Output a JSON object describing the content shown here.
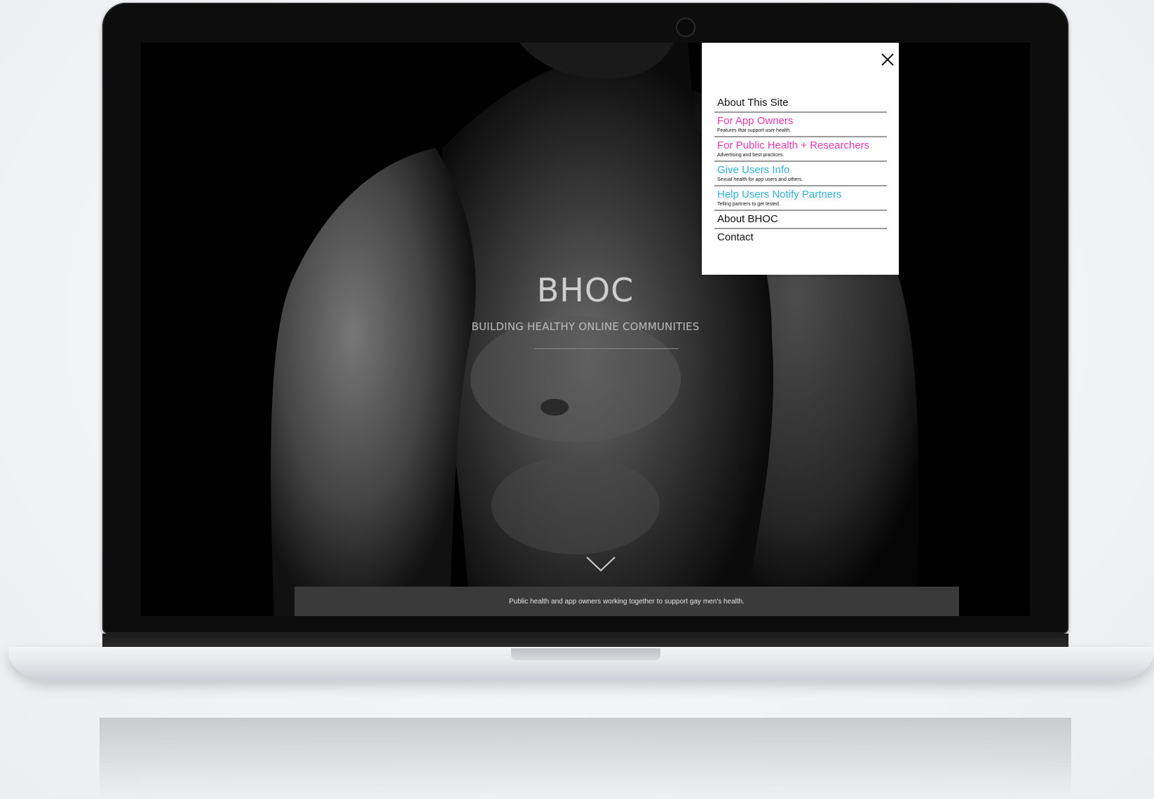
{
  "hero": {
    "title": "BHOC",
    "subtitle": "BUILDING HEALTHY ONLINE COMMUNITIES"
  },
  "footer": {
    "text": "Public health and app owners working together to support gay men's health."
  },
  "menu": {
    "items": [
      {
        "label": "About This Site",
        "description": "",
        "color": "#111111"
      },
      {
        "label": "For App Owners",
        "description": "Features that support user health.",
        "color": "#e63aa6"
      },
      {
        "label": "For Public Health + Researchers",
        "description": "Advertising and best practices.",
        "color": "#e63aa6"
      },
      {
        "label": "Give Users Info",
        "description": "Sexual health for app users and others.",
        "color": "#2fb2d8"
      },
      {
        "label": "Help Users Notify Partners",
        "description": "Telling partners to get tested.",
        "color": "#2fb2d8"
      },
      {
        "label": "About BHOC",
        "description": "",
        "color": "#111111"
      },
      {
        "label": "Contact",
        "description": "",
        "color": "#111111"
      }
    ]
  },
  "icons": {
    "close": "close-icon",
    "scroll": "chevron-down-icon",
    "camera": "camera-icon"
  }
}
